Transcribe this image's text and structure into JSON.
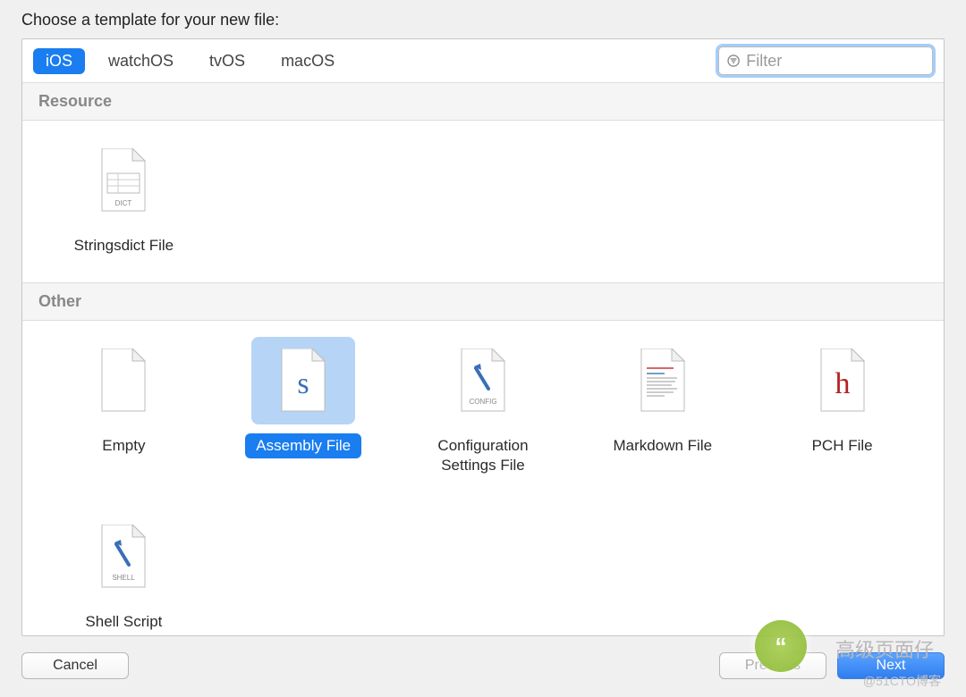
{
  "title": "Choose a template for your new file:",
  "tabs": {
    "items": [
      "iOS",
      "watchOS",
      "tvOS",
      "macOS"
    ],
    "active_index": 0
  },
  "filter": {
    "placeholder": "Filter",
    "value": ""
  },
  "sections": [
    {
      "name": "Resource",
      "items": [
        {
          "label": "Stringsdict File",
          "icon": "dict",
          "selected": false
        }
      ]
    },
    {
      "name": "Other",
      "items": [
        {
          "label": "Empty",
          "icon": "blank",
          "selected": false
        },
        {
          "label": "Assembly File",
          "icon": "s",
          "selected": true
        },
        {
          "label": "Configuration Settings File",
          "icon": "config",
          "selected": false
        },
        {
          "label": "Markdown File",
          "icon": "markdown",
          "selected": false
        },
        {
          "label": "PCH File",
          "icon": "h",
          "selected": false
        },
        {
          "label": "Shell Script",
          "icon": "shell",
          "selected": false
        }
      ]
    }
  ],
  "footer": {
    "cancel": "Cancel",
    "previous": "Previous",
    "next": "Next"
  },
  "watermark": {
    "text": "高级页面仔",
    "sub": "@51CTO博客"
  }
}
